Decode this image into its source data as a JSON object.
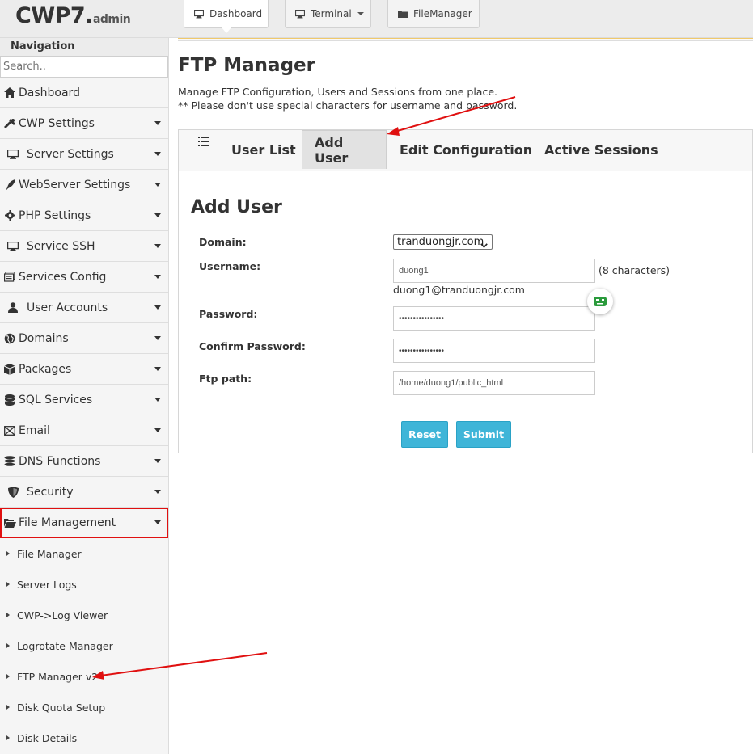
{
  "header": {
    "logo_main": "CWP7",
    "logo_dot": ".",
    "logo_sub": "admin",
    "buttons": [
      {
        "label": "Dashboard",
        "icon": "monitor-icon"
      },
      {
        "label": "Terminal",
        "icon": "monitor-icon"
      },
      {
        "label": "FileManager",
        "icon": "folder-icon"
      }
    ]
  },
  "sidebar": {
    "title": "Navigation",
    "search_placeholder": "Search..",
    "items": [
      {
        "label": "Dashboard",
        "icon": "home-icon"
      },
      {
        "label": "CWP Settings",
        "icon": "tools-icon"
      },
      {
        "label": "Server Settings",
        "icon": "server-icon"
      },
      {
        "label": "WebServer Settings",
        "icon": "feather-icon"
      },
      {
        "label": "PHP Settings",
        "icon": "gear-icon"
      },
      {
        "label": "Service SSH",
        "icon": "monitor-icon"
      },
      {
        "label": "Services Config",
        "icon": "stack-icon"
      },
      {
        "label": "User Accounts",
        "icon": "user-icon"
      },
      {
        "label": "Domains",
        "icon": "globe-icon"
      },
      {
        "label": "Packages",
        "icon": "cubes-icon"
      },
      {
        "label": "SQL Services",
        "icon": "database-icon"
      },
      {
        "label": "Email",
        "icon": "envelope-icon"
      },
      {
        "label": "DNS Functions",
        "icon": "dns-icon"
      },
      {
        "label": "Security",
        "icon": "shield-icon"
      },
      {
        "label": "File Management",
        "icon": "folder-open-icon"
      }
    ],
    "sub_items": [
      "File Manager",
      "Server Logs",
      "CWP->Log Viewer",
      "Logrotate Manager",
      "FTP Manager v2",
      "Disk Quota Setup",
      "Disk Details"
    ]
  },
  "main": {
    "title": "FTP Manager",
    "desc_line1": "Manage FTP Configuration, Users and Sessions from one place.",
    "desc_line2": "** Please don't use special characters for username and password.",
    "tabs": [
      "User List",
      "Add User",
      "Edit Configuration",
      "Active Sessions"
    ],
    "active_tab": "Add User",
    "form": {
      "title": "Add User",
      "domain_label": "Domain:",
      "domain_value": "tranduongjr.com",
      "username_label": "Username:",
      "username_value": "duong1",
      "username_hint": "(8 characters)",
      "email_note": "duong1@tranduongjr.com",
      "password_label": "Password:",
      "password_value": "••••••••••••••••",
      "confirm_label": "Confirm Password:",
      "confirm_value": "••••••••••••••••",
      "path_label": "Ftp path:",
      "path_value": "/home/duong1/public_html",
      "reset_label": "Reset",
      "submit_label": "Submit"
    }
  },
  "colors": {
    "accent_button": "#3fb5d8",
    "highlight_red": "#e01010"
  }
}
